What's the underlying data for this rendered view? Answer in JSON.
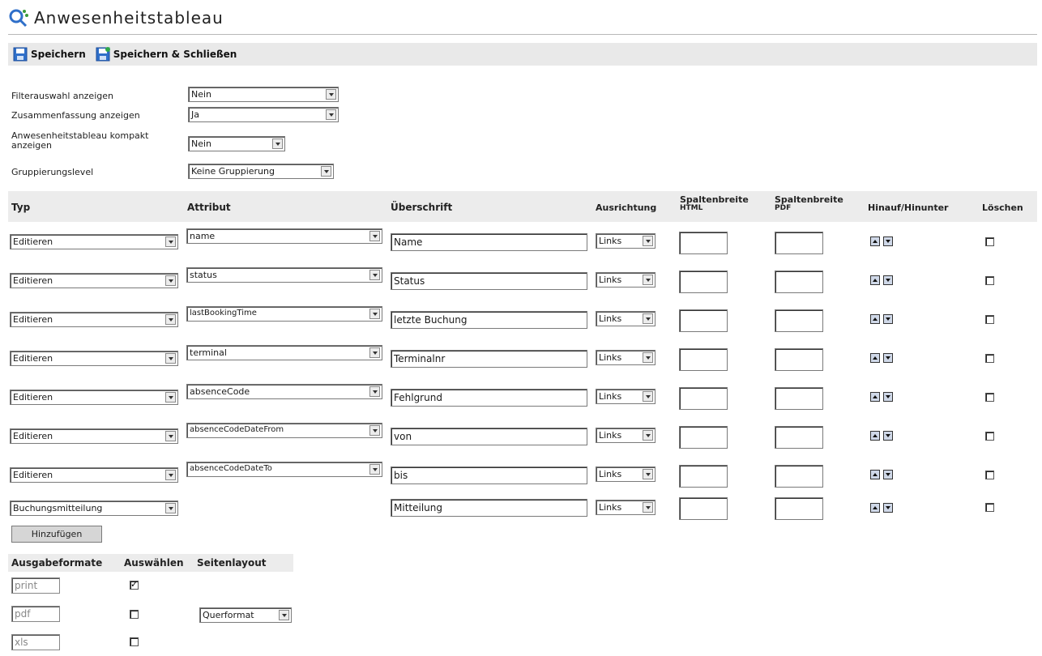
{
  "page": {
    "title": "Anwesenheitstableau"
  },
  "toolbar": {
    "save_label": "Speichern",
    "save_close_label": "Speichern & Schließen"
  },
  "settings": [
    {
      "label": "Filterauswahl anzeigen",
      "value": "Nein"
    },
    {
      "label": "Zusammenfassung anzeigen",
      "value": "Ja"
    },
    {
      "label": "Anwesenheitstableau kompakt anzeigen",
      "value": "Nein"
    },
    {
      "label": "Gruppierungslevel",
      "value": "Keine Gruppierung"
    }
  ],
  "columns": {
    "typ": "Typ",
    "attribut": "Attribut",
    "ueberschrift": "Überschrift",
    "ausrichtung": "Ausrichtung",
    "spaltenbreite_html_1": "Spaltenbreite",
    "spaltenbreite_html_2": "HTML",
    "spaltenbreite_pdf_1": "Spaltenbreite",
    "spaltenbreite_pdf_2": "PDF",
    "hinauf_hinunter": "Hinauf/Hinunter",
    "loeschen": "Löschen"
  },
  "rows": [
    {
      "typ": "Editieren",
      "attribut": "name",
      "ueberschrift": "Name",
      "ausrichtung": "Links",
      "delete_checked": false
    },
    {
      "typ": "Editieren",
      "attribut": "status",
      "ueberschrift": "Status",
      "ausrichtung": "Links",
      "delete_checked": false
    },
    {
      "typ": "Editieren",
      "attribut": "lastBookingTime",
      "ueberschrift": "letzte Buchung",
      "ausrichtung": "Links",
      "delete_checked": false
    },
    {
      "typ": "Editieren",
      "attribut": "terminal",
      "ueberschrift": "Terminalnr",
      "ausrichtung": "Links",
      "delete_checked": false
    },
    {
      "typ": "Editieren",
      "attribut": "absenceCode",
      "ueberschrift": "Fehlgrund",
      "ausrichtung": "Links",
      "delete_checked": false
    },
    {
      "typ": "Editieren",
      "attribut": "absenceCodeDateFrom",
      "ueberschrift": "von",
      "ausrichtung": "Links",
      "delete_checked": false
    },
    {
      "typ": "Editieren",
      "attribut": "absenceCodeDateTo",
      "ueberschrift": "bis",
      "ausrichtung": "Links",
      "delete_checked": false
    },
    {
      "typ": "Buchungsmitteilung",
      "attribut": "",
      "ueberschrift": "Mitteilung",
      "ausrichtung": "Links",
      "delete_checked": false
    }
  ],
  "add_button": "Hinzufügen",
  "formats": {
    "headers": {
      "format": "Ausgabeformate",
      "select": "Auswählen",
      "layout": "Seitenlayout"
    },
    "items": [
      {
        "name": "print",
        "checked": true,
        "layout": ""
      },
      {
        "name": "pdf",
        "checked": false,
        "layout": "Querformat"
      },
      {
        "name": "xls",
        "checked": false,
        "layout": ""
      }
    ]
  },
  "colors": {
    "toolbar_bg": "#e9e9e9",
    "header_bg": "#ececec",
    "icon_blue": "#2f6fc9"
  }
}
